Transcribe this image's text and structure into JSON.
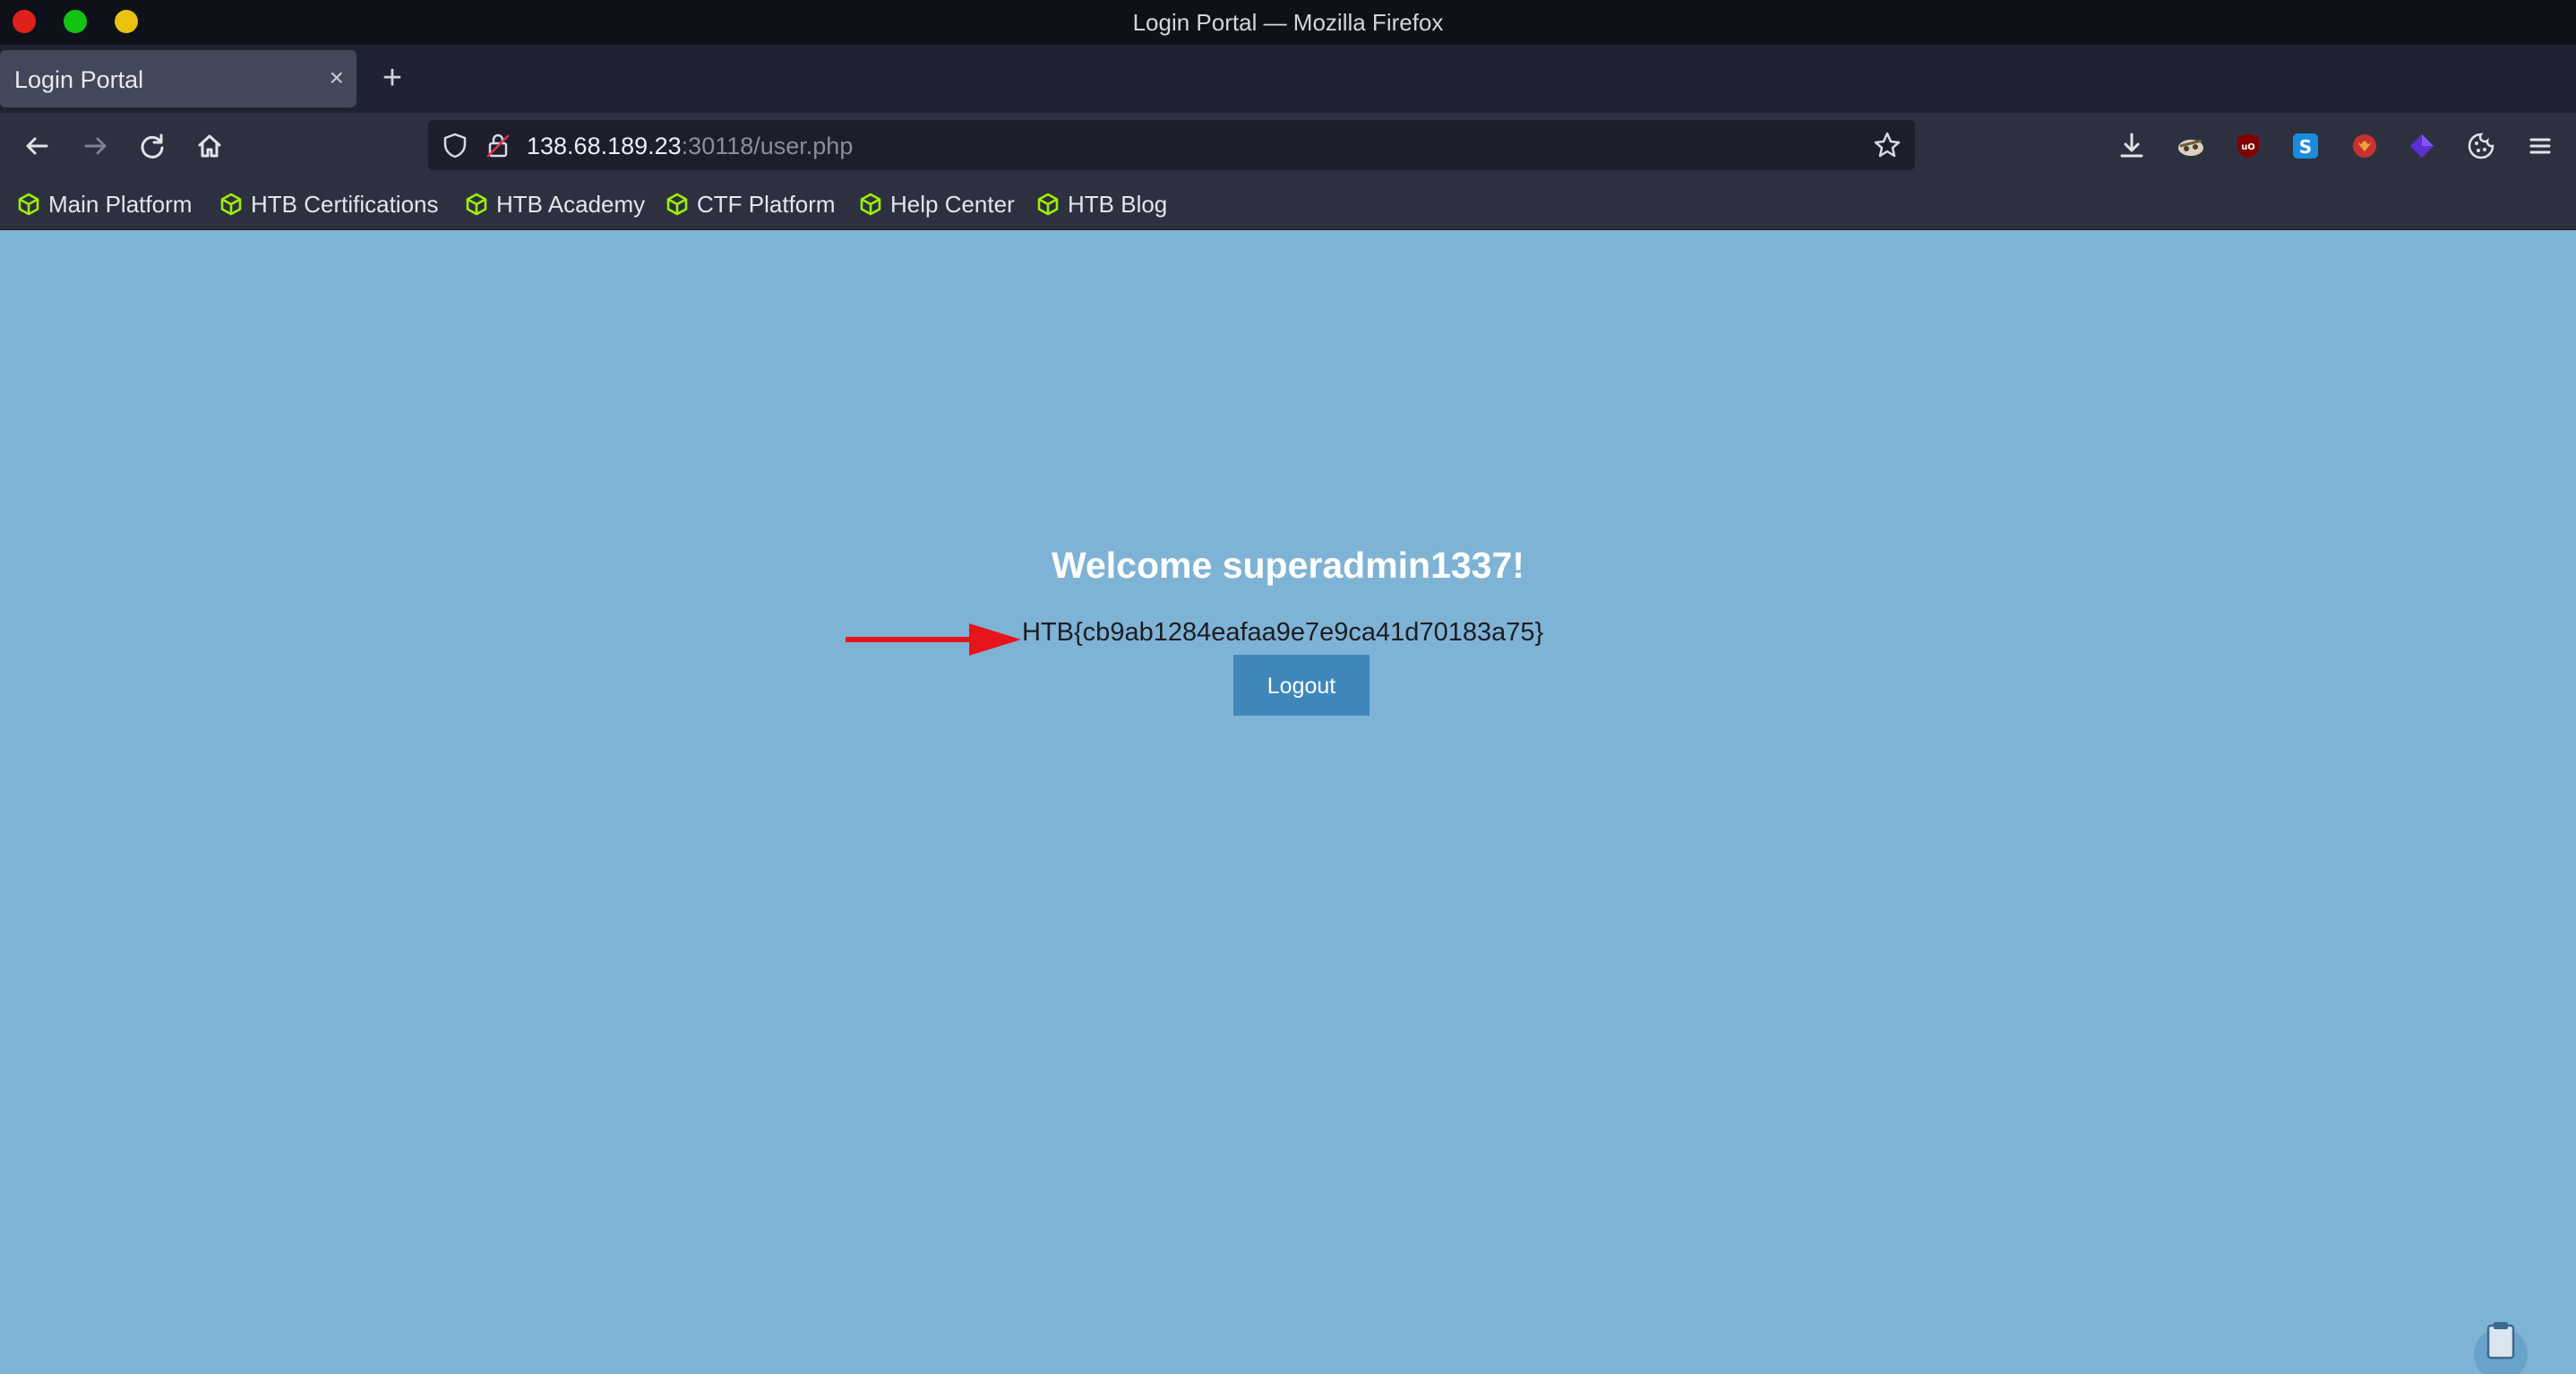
{
  "window": {
    "title": "Login Portal — Mozilla Firefox"
  },
  "tabs": [
    {
      "label": "Login Portal",
      "close_glyph": "×"
    }
  ],
  "new_tab_glyph": "+",
  "navbar": {
    "url_host": "138.68.189.23",
    "url_rest": ":30118/user.php"
  },
  "bookmarks": [
    {
      "label": "Main Platform",
      "icon": "htb-cube-icon"
    },
    {
      "label": "HTB Certifications",
      "icon": "htb-cube-icon"
    },
    {
      "label": "HTB Academy",
      "icon": "htb-cube-icon"
    },
    {
      "label": "CTF Platform",
      "icon": "htb-cube-icon"
    },
    {
      "label": "Help Center",
      "icon": "htb-cube-icon"
    },
    {
      "label": "HTB Blog",
      "icon": "htb-cube-icon"
    }
  ],
  "extensions": [
    "download-icon",
    "tracker-extension-icon",
    "ublock-icon",
    "s-extension-icon",
    "fox-extension-icon",
    "purple-gem-extension-icon",
    "cookie-icon",
    "menu-icon"
  ],
  "page": {
    "welcome": "Welcome superadmin1337!",
    "flag": "HTB{cb9ab1284eafaa9e7e9ca41d70183a75}",
    "logout_label": "Logout"
  },
  "colors": {
    "page_background": "#7fb3d5",
    "logout_button": "#3f87bb",
    "arrow": "#e8141b",
    "bookmark_icon": "#9fef00"
  }
}
